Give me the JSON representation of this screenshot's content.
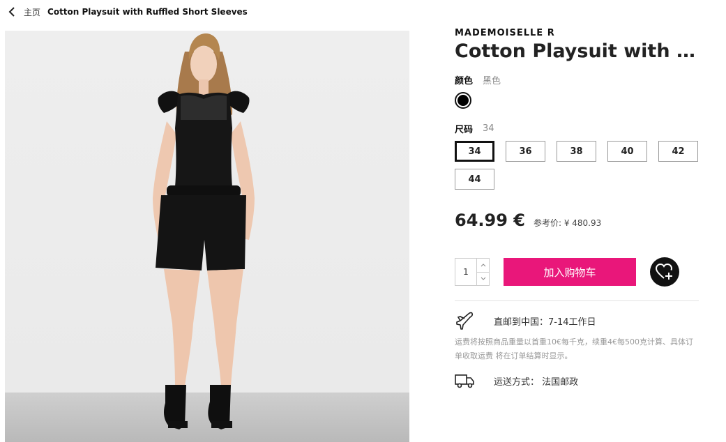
{
  "breadcrumb": {
    "home": "主页",
    "current": "Cotton Playsuit with Ruffled Short Sleeves"
  },
  "product": {
    "brand": "MADEMOISELLE R",
    "title": "Cotton Playsuit with Ruffled Short Sleeves",
    "image_alt": "Model wearing black cotton playsuit"
  },
  "color": {
    "label": "颜色",
    "value": "黑色",
    "swatch": "#000000"
  },
  "size": {
    "label": "尺码",
    "value": "34",
    "options": [
      "34",
      "36",
      "38",
      "40",
      "42",
      "44"
    ],
    "selected": "34"
  },
  "price": {
    "amount": "64.99 €",
    "reference": "参考价: ¥ 480.93"
  },
  "cart": {
    "quantity": "1",
    "add_label": "加入购物车",
    "accent": "#e9177a"
  },
  "shipping": {
    "direct": "直邮到中国：7-14工作日",
    "note": "运费将按照商品重量以首重10€每千克，续重4€每500克计算、具体订单收取运费 将在订单结算时显示。",
    "method": "运送方式： 法国邮政"
  },
  "icons": {
    "back": "chevron-left-icon",
    "plane": "airplane-icon",
    "truck": "truck-icon",
    "wishlist": "heart-plus-icon"
  }
}
